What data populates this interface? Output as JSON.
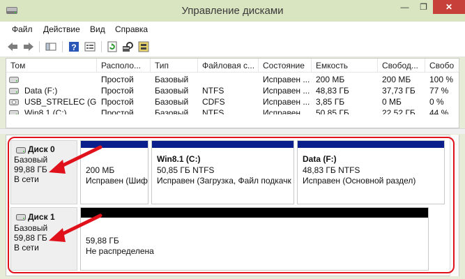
{
  "window": {
    "title": "Управление дисками",
    "min_glyph": "—",
    "max_glyph": "❐",
    "close_glyph": "✕"
  },
  "menu": [
    "Файл",
    "Действие",
    "Вид",
    "Справка"
  ],
  "toolbar": {
    "icons": [
      "back-icon",
      "forward-icon",
      "pane-icon",
      "help-icon",
      "properties-icon",
      "refresh-icon",
      "settings-icon",
      "disk-wizard-icon"
    ]
  },
  "volume_list": {
    "columns": [
      "Том",
      "Располо...",
      "Тип",
      "Файловая с...",
      "Состояние",
      "Емкость",
      "Свобод...",
      "Свобо"
    ],
    "rows": [
      [
        "",
        "Простой",
        "Базовый",
        "",
        "Исправен ...",
        "200 МБ",
        "200 МБ",
        "100 %"
      ],
      [
        "Data (F:)",
        "Простой",
        "Базовый",
        "NTFS",
        "Исправен ...",
        "48,83 ГБ",
        "37,73 ГБ",
        "77 %"
      ],
      [
        "USB_STRELEC (G:)",
        "Простой",
        "Базовый",
        "CDFS",
        "Исправен ...",
        "3,85 ГБ",
        "0 МБ",
        "0 %"
      ],
      [
        "Win8.1 (C:)",
        "Простой",
        "Базовый",
        "NTFS",
        "Исправен ...",
        "50,85 ГБ",
        "22,52 ГБ",
        "44 %"
      ]
    ]
  },
  "disks": [
    {
      "name": "Диск 0",
      "type": "Базовый",
      "size": "99,88 ГБ",
      "status": "В сети",
      "partitions": [
        {
          "name": "",
          "size": "200 МБ",
          "status": "Исправен (Шиф",
          "bar_color": "#0b1f8c"
        },
        {
          "name": "Win8.1  (C:)",
          "size": "50,85 ГБ NTFS",
          "status": "Исправен (Загрузка, Файл подкачк",
          "bar_color": "#0b1f8c"
        },
        {
          "name": "Data  (F:)",
          "size": "48,83 ГБ NTFS",
          "status": "Исправен (Основной раздел)",
          "bar_color": "#0b1f8c"
        }
      ]
    },
    {
      "name": "Диск 1",
      "type": "Базовый",
      "size": "59,88 ГБ",
      "status": "В сети",
      "partitions": [
        {
          "name": "",
          "size": "59,88 ГБ",
          "status": "Не распределена",
          "bar_color": "#000000"
        }
      ]
    }
  ],
  "colors": {
    "highlight": "#e0111b",
    "arrow": "#e0111b",
    "primary_partition": "#0b1f8c",
    "unallocated": "#000000"
  }
}
